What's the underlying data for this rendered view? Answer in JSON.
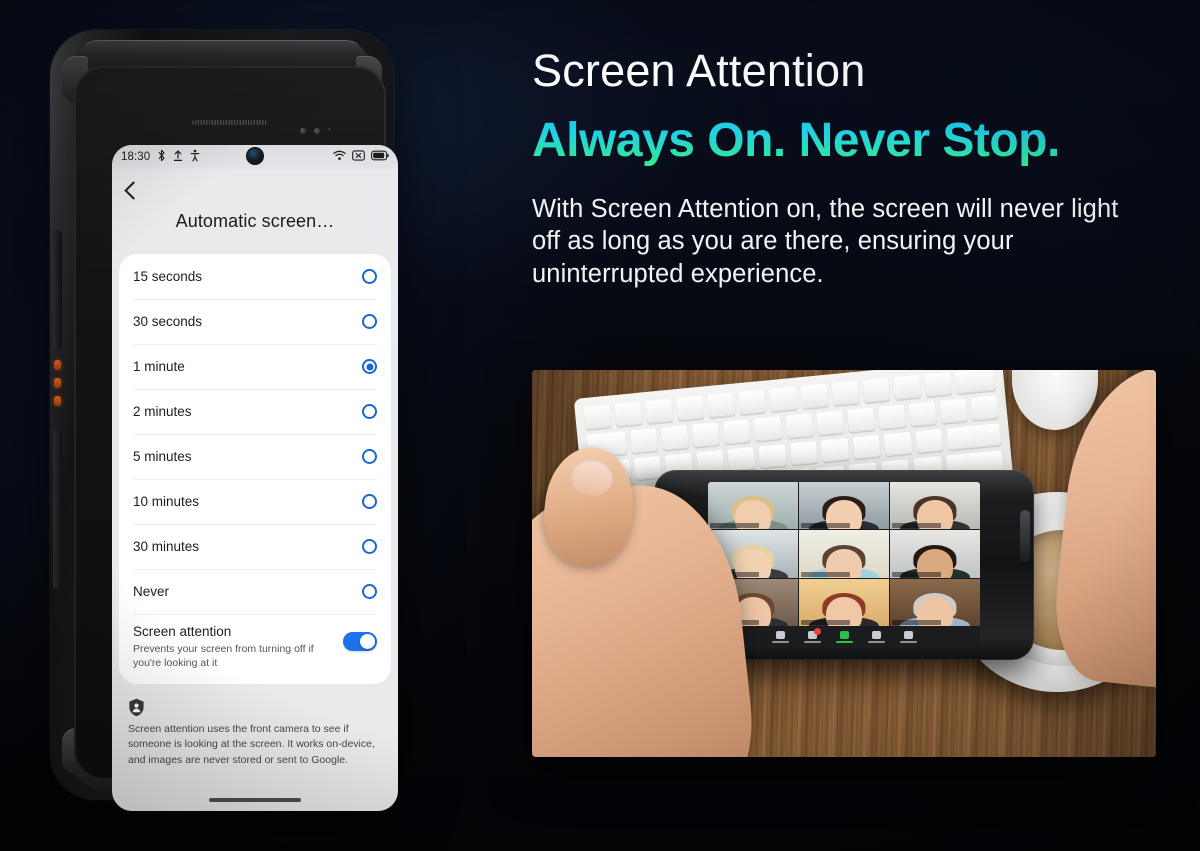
{
  "background": {
    "color": "#05060a",
    "glow": "#182a52"
  },
  "phone": {
    "status_bar": {
      "time": "18:30",
      "icons_left": [
        "bluetooth-icon",
        "upload-icon",
        "accessibility-icon"
      ],
      "icons_right": [
        "wifi-icon",
        "no-sim-icon",
        "battery-icon"
      ]
    },
    "app_bar": {
      "back_label": "back-chevron",
      "title": "Automatic screen…"
    },
    "options": [
      {
        "label": "15 seconds",
        "selected": false
      },
      {
        "label": "30 seconds",
        "selected": false
      },
      {
        "label": "1 minute",
        "selected": true
      },
      {
        "label": "2 minutes",
        "selected": false
      },
      {
        "label": "5 minutes",
        "selected": false
      },
      {
        "label": "10 minutes",
        "selected": false
      },
      {
        "label": "30 minutes",
        "selected": false
      },
      {
        "label": "Never",
        "selected": false
      }
    ],
    "screen_attention": {
      "title": "Screen attention",
      "subtitle": "Prevents your screen from turning off if you're looking at it",
      "toggle_on": true,
      "toggle_color": "#1a73e8"
    },
    "footer_note": {
      "icon": "privacy-shield-icon",
      "text": "Screen attention uses the front camera to see if someone is looking at the screen. It works on-device, and images are never stored or sent to Google."
    },
    "accent_color": "#1967d2"
  },
  "right_panel": {
    "heading": "Screen Attention",
    "subheading": "Always On. Never Stop.",
    "subheading_gradient": [
      "#16c7f0",
      "#35ee93"
    ],
    "body": "With Screen Attention on, the screen will never light off as long as you are there, ensuring your uninterrupted experience.",
    "photo": {
      "description": "Hands holding a rugged smartphone showing a nine person video call, on a wooden desk with a white keyboard and a cup of coffee",
      "call_participants": 9,
      "active_speaker_index": 4,
      "toolbar_buttons": [
        "participants",
        "chat",
        "share-screen",
        "record",
        "reactions"
      ]
    }
  }
}
